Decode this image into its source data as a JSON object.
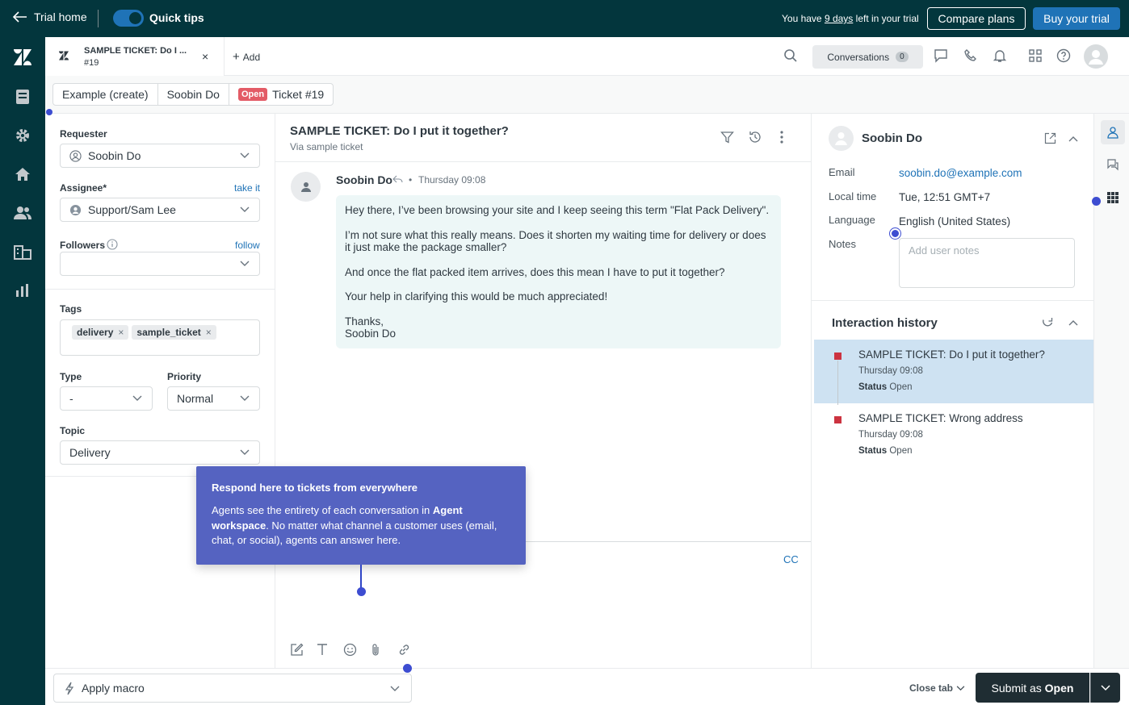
{
  "topbar": {
    "back_label": "Trial home",
    "quick_tips_label": "Quick tips",
    "trial_prefix": "You have ",
    "trial_days": "9 days",
    "trial_suffix": " left in your trial",
    "compare_label": "Compare plans",
    "buy_label": "Buy your trial"
  },
  "tabs": {
    "ticket_title": "SAMPLE TICKET: Do I ...",
    "ticket_number": "#19",
    "close_glyph": "×",
    "add_label": "Add",
    "conversations_label": "Conversations",
    "conversations_count": "0"
  },
  "breadcrumb": {
    "items": [
      "Example (create)",
      "Soobin Do"
    ],
    "status_badge": "Open",
    "ticket_label": "Ticket #19"
  },
  "properties": {
    "requester_label": "Requester",
    "requester_value": "Soobin Do",
    "assignee_label": "Assignee*",
    "assignee_link": "take it",
    "assignee_value": "Support/Sam Lee",
    "followers_label": "Followers",
    "followers_link": "follow",
    "tags_label": "Tags",
    "tags": [
      "delivery",
      "sample_ticket"
    ],
    "type_label": "Type",
    "type_value": "-",
    "priority_label": "Priority",
    "priority_value": "Normal",
    "topic_label": "Topic",
    "topic_value": "Delivery"
  },
  "conversation": {
    "subject": "SAMPLE TICKET: Do I put it together?",
    "via": "Via sample ticket",
    "author": "Soobin Do",
    "time": "Thursday 09:08",
    "paragraphs": [
      "Hey there, I’ve been browsing your site and I keep seeing this term \"Flat Pack Delivery\".",
      "I’m not sure what this really means. Does it shorten my waiting time for delivery or does it just make the package smaller?",
      "And once the flat packed item arrives, does this mean I have to put it together?",
      "Your help in clarifying this would be much appreciated!"
    ],
    "signoff_1": "Thanks,",
    "signoff_2": "Soobin Do",
    "cc_label": "CC"
  },
  "tooltip": {
    "title": "Respond here to tickets from everywhere",
    "body_1": "Agents see the entirety of each conversation in ",
    "body_bold": "Agent workspace",
    "body_2": ". No matter what channel a customer uses (email, chat, or social), agents can answer here."
  },
  "customer": {
    "name": "Soobin Do",
    "email_label": "Email",
    "email_value": "soobin.do@example.com",
    "local_time_label": "Local time",
    "local_time_value": "Tue, 12:51 GMT+7",
    "language_label": "Language",
    "language_value": "English (United States)",
    "notes_label": "Notes",
    "notes_placeholder": "Add user notes"
  },
  "interaction_history": {
    "title": "Interaction history",
    "items": [
      {
        "subject": "SAMPLE TICKET: Do I put it together?",
        "time": "Thursday 09:08",
        "status_label": "Status",
        "status_value": "Open"
      },
      {
        "subject": "SAMPLE TICKET: Wrong address",
        "time": "Thursday 09:08",
        "status_label": "Status",
        "status_value": "Open"
      }
    ]
  },
  "bottombar": {
    "macro_label": "Apply macro",
    "close_tab_label": "Close tab",
    "submit_prefix": "Submit as ",
    "submit_status": "Open"
  },
  "colors": {
    "brand_dark": "#03363d",
    "accent_blue": "#1f73b7",
    "tooltip_bg": "#5563c1",
    "status_open": "#e35b66"
  }
}
